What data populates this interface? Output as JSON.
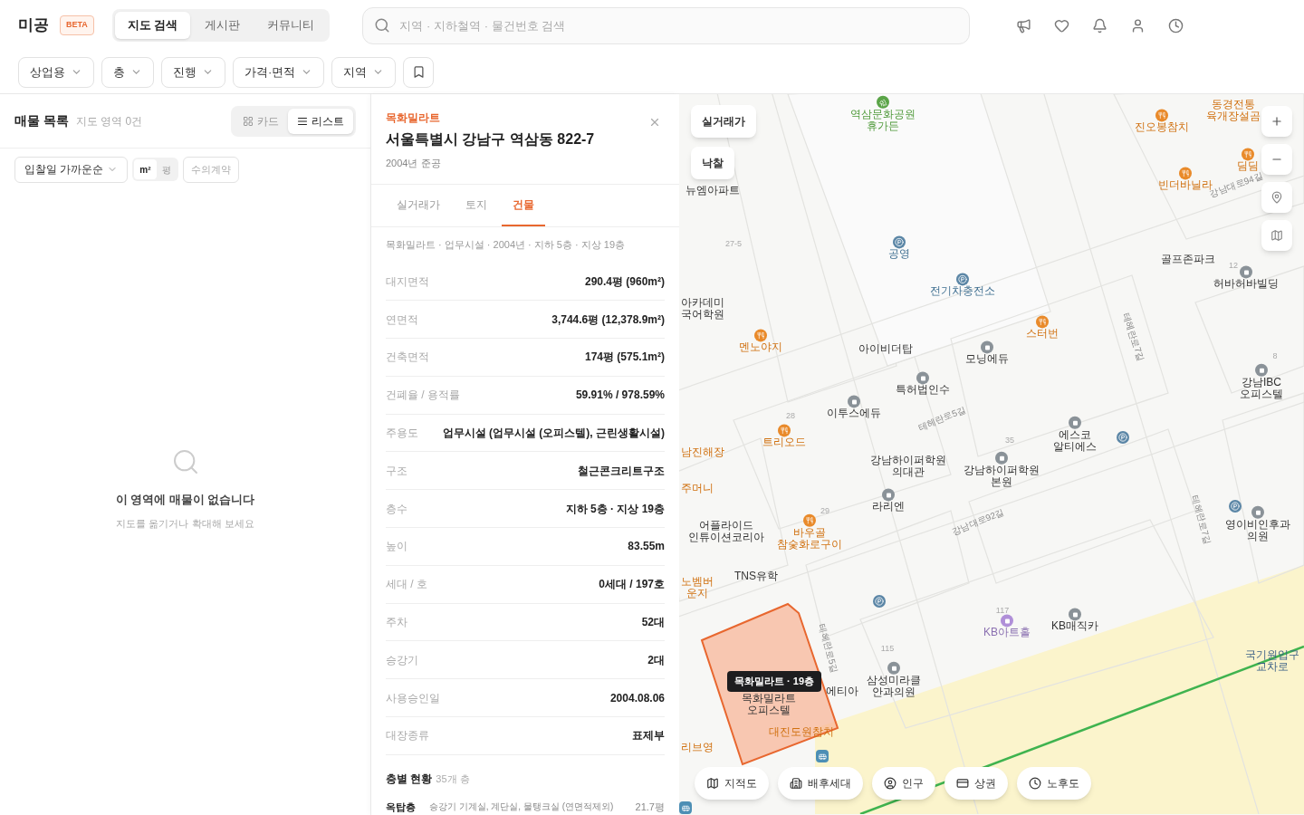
{
  "header": {
    "logo": "미공",
    "badge": "BETA",
    "nav_tabs": [
      {
        "label": "지도 검색",
        "selected": true
      },
      {
        "label": "게시판",
        "selected": false
      },
      {
        "label": "커뮤니티",
        "selected": false
      }
    ],
    "search": {
      "placeholder": "지역 · 지하철역 · 물건번호 검색"
    }
  },
  "filters": [
    "상업용",
    "층",
    "진행",
    "가격·면적",
    "지역"
  ],
  "list_panel": {
    "title": "매물 목록",
    "count": "지도 영역 0건",
    "view_toggle": [
      {
        "label": "카드",
        "selected": false
      },
      {
        "label": "리스트",
        "selected": true
      }
    ],
    "sort": "입찰일 가까운순",
    "unit_toggle": [
      {
        "label": "m²",
        "selected": true
      },
      {
        "label": "평",
        "selected": false
      }
    ],
    "contract_filter": "수의계약",
    "empty": {
      "title": "이 영역에 매물이 없습니다",
      "hint": "지도를 옮기거나 확대해 보세요"
    }
  },
  "detail": {
    "category": "목화밀라트",
    "address": "서울특별시 강남구 역삼동 822-7",
    "built": "2004년 준공",
    "tabs": [
      {
        "label": "실거래가",
        "selected": false
      },
      {
        "label": "토지",
        "selected": false
      },
      {
        "label": "건물",
        "selected": true
      }
    ],
    "summary": "목화밀라트 · 업무시설 · 2004년 · 지하 5층 · 지상 19층",
    "rows": [
      {
        "label": "대지면적",
        "value": "290.4평 (960m²)"
      },
      {
        "label": "연면적",
        "value": "3,744.6평 (12,378.9m²)"
      },
      {
        "label": "건축면적",
        "value": "174평 (575.1m²)"
      },
      {
        "label": "건폐율 / 용적률",
        "value": "59.91% / 978.59%"
      },
      {
        "label": "주용도",
        "value": "업무시설 (업무시설 (오피스텔), 근린생활시설)"
      },
      {
        "label": "구조",
        "value": "철근콘크리트구조"
      },
      {
        "label": "층수",
        "value": "지하 5층 · 지상 19층"
      },
      {
        "label": "높이",
        "value": "83.55m"
      },
      {
        "label": "세대 / 호",
        "value": "0세대 / 197호"
      },
      {
        "label": "주차",
        "value": "52대"
      },
      {
        "label": "승강기",
        "value": "2대"
      },
      {
        "label": "사용승인일",
        "value": "2004.08.06"
      },
      {
        "label": "대장종류",
        "value": "표제부"
      }
    ],
    "floors": {
      "title": "층별 현황",
      "count": "35개 층",
      "rows": [
        {
          "floor": "옥탑층",
          "use": "승강기 기계실, 계단실, 물탱크실 (연면적제외)",
          "area": "21.7평"
        }
      ]
    }
  },
  "map": {
    "layer_buttons": [
      "실거래가",
      "낙찰"
    ],
    "labels": [
      {
        "text": "역삼문화공원\n휴가든",
        "kind": "park"
      },
      {
        "text": "뉴엠아파트",
        "kind": "plain"
      },
      {
        "text": "공영",
        "kind": "parking"
      },
      {
        "text": "전기차충전소",
        "kind": "parking"
      },
      {
        "text": "진오봉참치",
        "kind": "food"
      },
      {
        "text": "동경전통\n육개장설곰",
        "kind": "foodtext"
      },
      {
        "text": "딤딤",
        "kind": "food"
      },
      {
        "text": "빈더바닐라",
        "kind": "food"
      },
      {
        "text": "강남대로94길",
        "kind": "road"
      },
      {
        "text": "골프존파크",
        "kind": "plain"
      },
      {
        "text": "허바허바빌딩",
        "kind": "place"
      },
      {
        "text": "아카데미\n국어학원",
        "kind": "plain"
      },
      {
        "text": "멘노야지",
        "kind": "food"
      },
      {
        "text": "아이비더탑",
        "kind": "plain"
      },
      {
        "text": "모닝에듀",
        "kind": "place"
      },
      {
        "text": "스터번",
        "kind": "food"
      },
      {
        "text": "특허법인수",
        "kind": "place"
      },
      {
        "text": "테헤란로7길",
        "kind": "road"
      },
      {
        "text": "이투스에듀",
        "kind": "place"
      },
      {
        "text": "트리오드",
        "kind": "food"
      },
      {
        "text": "테헤란로5길",
        "kind": "road"
      },
      {
        "text": "강남IBC\n오피스텔",
        "kind": "place"
      },
      {
        "text": "에스코\n알티에스",
        "kind": "place"
      },
      {
        "text": "남진해장",
        "kind": "foodtext"
      },
      {
        "text": "강남하이퍼학원\n의대관",
        "kind": "plain"
      },
      {
        "text": "강남하이퍼학원\n본원",
        "kind": "place"
      },
      {
        "text": "주머니",
        "kind": "foodtext"
      },
      {
        "text": "라리엔",
        "kind": "place"
      },
      {
        "text": "바우골\n참숯화로구이",
        "kind": "food"
      },
      {
        "text": "어플라이드\n인튜이션코리아",
        "kind": "plain"
      },
      {
        "text": "강남대로92길",
        "kind": "road"
      },
      {
        "text": "테헤란로7길",
        "kind": "road"
      },
      {
        "text": "영이비인후과\n의원",
        "kind": "place"
      },
      {
        "text": "TNS유학",
        "kind": "plain"
      },
      {
        "text": "노벰버\n운지",
        "kind": "foodtext"
      },
      {
        "text": "KB아트홀",
        "kind": "venue"
      },
      {
        "text": "KB매직카",
        "kind": "place"
      },
      {
        "text": "국기원입구\n교차로",
        "kind": "transit"
      },
      {
        "text": "테헤란로5길",
        "kind": "road"
      },
      {
        "text": "에티아",
        "kind": "plain"
      },
      {
        "text": "삼성미라클\n안과의원",
        "kind": "place"
      },
      {
        "text": "목화밀라트\n오피스텔",
        "kind": "plain"
      },
      {
        "text": "대진도원참치",
        "kind": "foodtext"
      },
      {
        "text": "리브영",
        "kind": "foodtext"
      },
      {
        "text": "27-5",
        "kind": "lot"
      },
      {
        "text": "28",
        "kind": "lot"
      },
      {
        "text": "29",
        "kind": "lot"
      },
      {
        "text": "35",
        "kind": "lot"
      },
      {
        "text": "12",
        "kind": "lot"
      },
      {
        "text": "8",
        "kind": "lot"
      },
      {
        "text": "115",
        "kind": "lot"
      },
      {
        "text": "117",
        "kind": "lot"
      }
    ],
    "parcel_tooltip": "목화밀라트 · 19층",
    "layer_chips": [
      {
        "label": "지적도",
        "kind": "map"
      },
      {
        "label": "배후세대",
        "kind": "building"
      },
      {
        "label": "인구",
        "kind": "person"
      },
      {
        "label": "상권",
        "kind": "card"
      },
      {
        "label": "노후도",
        "kind": "clock"
      }
    ]
  }
}
